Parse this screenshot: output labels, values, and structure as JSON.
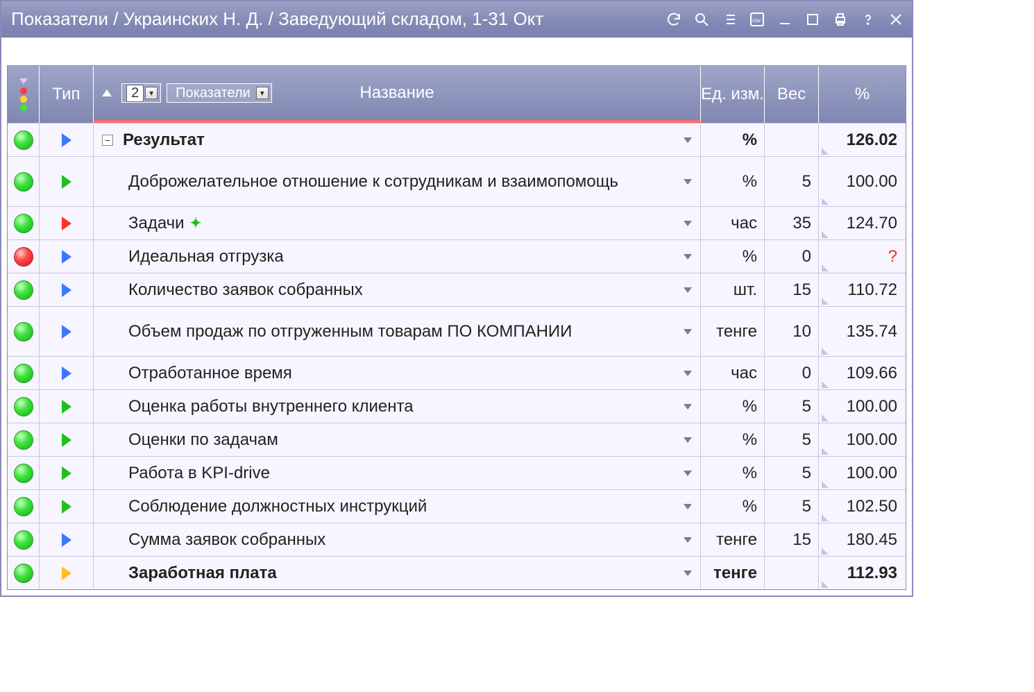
{
  "titlebar": {
    "title": "Показатели / Украинских Н. Д. / Заведующий складом, 1-31 Окт"
  },
  "header": {
    "type": "Тип",
    "name": "Название",
    "level_value": "2",
    "dropdown_label": "Показатели",
    "unit": "Ед. изм.",
    "weight": "Вес",
    "percent": "%"
  },
  "rows": [
    {
      "status": "green",
      "type": "blue",
      "name": "Результат",
      "unit": "%",
      "weight": "",
      "percent": "126.02",
      "bold": true,
      "expandable": true,
      "indent": 0
    },
    {
      "status": "green",
      "type": "green",
      "name": "Доброжелательное отношение к сотрудникам и взаимопомощь",
      "unit": "%",
      "weight": "5",
      "percent": "100.00",
      "indent": 1,
      "tall": true
    },
    {
      "status": "green",
      "type": "red",
      "name": "Задачи",
      "unit": "час",
      "weight": "35",
      "percent": "124.70",
      "indent": 1,
      "plus": true
    },
    {
      "status": "red",
      "type": "blue",
      "name": "Идеальная отгрузка",
      "unit": "%",
      "weight": "0",
      "percent": "?",
      "indent": 1,
      "red_q": true
    },
    {
      "status": "green",
      "type": "blue",
      "name": "Количество заявок собранных",
      "unit": "шт.",
      "weight": "15",
      "percent": "110.72",
      "indent": 1
    },
    {
      "status": "green",
      "type": "blue",
      "name": "Объем продаж по отгруженным товарам ПО КОМПАНИИ",
      "unit": "тенге",
      "weight": "10",
      "percent": "135.74",
      "indent": 1,
      "tall": true
    },
    {
      "status": "green",
      "type": "blue",
      "name": "Отработанное время",
      "unit": "час",
      "weight": "0",
      "percent": "109.66",
      "indent": 1
    },
    {
      "status": "green",
      "type": "green",
      "name": "Оценка работы внутреннего клиента",
      "unit": "%",
      "weight": "5",
      "percent": "100.00",
      "indent": 1
    },
    {
      "status": "green",
      "type": "green",
      "name": "Оценки по задачам",
      "unit": "%",
      "weight": "5",
      "percent": "100.00",
      "indent": 1
    },
    {
      "status": "green",
      "type": "green",
      "name": "Работа в KPI-drive",
      "unit": "%",
      "weight": "5",
      "percent": "100.00",
      "indent": 1
    },
    {
      "status": "green",
      "type": "green",
      "name": "Соблюдение должностных инструкций",
      "unit": "%",
      "weight": "5",
      "percent": "102.50",
      "indent": 1
    },
    {
      "status": "green",
      "type": "blue",
      "name": "Сумма заявок собранных",
      "unit": "тенге",
      "weight": "15",
      "percent": "180.45",
      "indent": 1
    },
    {
      "status": "green",
      "type": "yellow",
      "name": "Заработная плата",
      "unit": "тенге",
      "weight": "",
      "percent": "112.93",
      "bold": true,
      "indent": 1
    }
  ]
}
